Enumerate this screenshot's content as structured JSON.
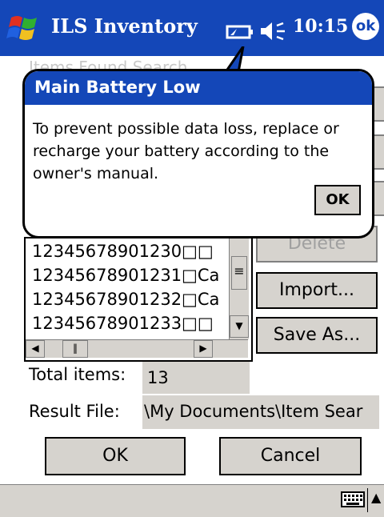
{
  "titlebar": {
    "title": "ILS Inventory",
    "time": "10:15",
    "ok_label": "ok",
    "color": "#1447b8"
  },
  "behind": {
    "partial_text": "Items Found Search"
  },
  "list": {
    "rows": [
      "12345678901230□□",
      "12345678901231□Ca",
      "12345678901232□Ca",
      "12345678901233□□"
    ]
  },
  "buttons": {
    "delete": "Delete",
    "import": "Import...",
    "save_as": "Save As...",
    "ok": "OK",
    "cancel": "Cancel"
  },
  "fields": {
    "total_items_label": "Total items:",
    "total_items_value": "13",
    "result_file_label": "Result File:",
    "result_file_value": "\\My Documents\\Item Sear"
  },
  "popup": {
    "title": "Main Battery Low",
    "message": "To prevent possible data loss, replace or recharge your battery according to the owner's manual.",
    "ok_label": "OK"
  },
  "icons": {
    "start": "windows-flag-icon",
    "battery": "battery-icon",
    "volume": "speaker-icon",
    "keyboard": "keyboard-icon",
    "sip_arrow": "up-arrow-icon"
  }
}
